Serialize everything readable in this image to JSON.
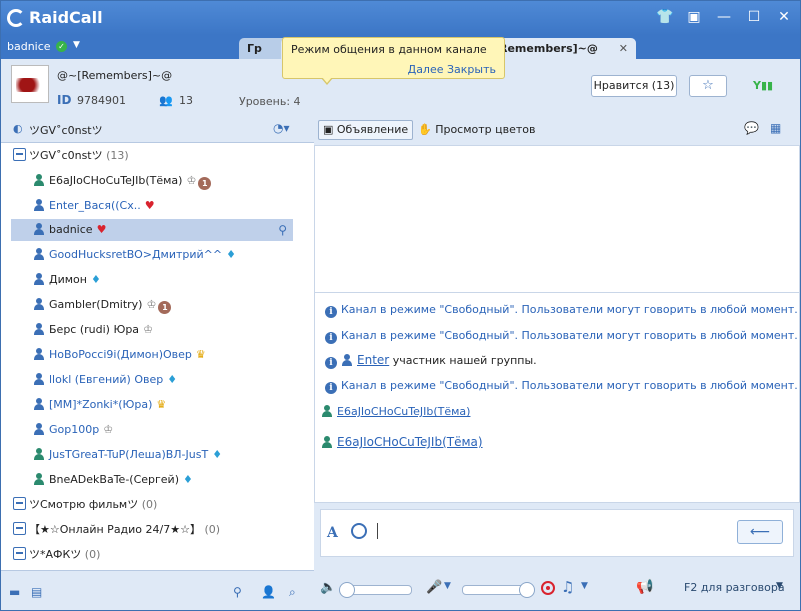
{
  "app": {
    "logo": "RaidCall"
  },
  "titlebar_icons": [
    "shirt-icon",
    "wardrobe-icon",
    "minimize-icon",
    "maximize-icon",
    "close-icon"
  ],
  "titlebar_glyphs": [
    "👕",
    "▣",
    "—",
    "☐",
    "✕"
  ],
  "user": {
    "name": "badnice"
  },
  "tabs": {
    "tab1": "Гр",
    "tab2": "Remembers]~@",
    "close": "✕"
  },
  "tooltip": {
    "text": "Режим общения в данном канале",
    "link": "Далее Закрыть"
  },
  "channel": {
    "name": "@~[Remembers]~@",
    "id_label": "ID",
    "id_value": "9784901",
    "members": "13",
    "level": "Уровень: 4",
    "like": "Нравится (13)",
    "star": "☆"
  },
  "left": {
    "header": "ツGV˚c0nstツ",
    "tree": [
      {
        "kind": "group",
        "label": "ツGV˚c0nstツ",
        "count": "(13)"
      },
      {
        "kind": "user",
        "label": "E6aJIoCHoCuTeJIb(Тёма)",
        "color": "#2b8a6e",
        "badges": [
          {
            "t": "♔",
            "c": "b-crown"
          },
          {
            "t": "1",
            "c": "b-num"
          }
        ]
      },
      {
        "kind": "user",
        "label": "Enter_Вася((Сх..",
        "color": "#3b6fb6",
        "badges": [
          {
            "t": "♥",
            "c": "b-heart"
          }
        ],
        "blue": true
      },
      {
        "kind": "user",
        "label": "badnice",
        "color": "#3b6fb6",
        "badges": [
          {
            "t": "♥",
            "c": "b-heart"
          }
        ],
        "selected": true
      },
      {
        "kind": "user",
        "label": "GoodHucksretBO>Дмитрий^^",
        "color": "#3b6fb6",
        "badges": [
          {
            "t": "♦",
            "c": "b-diam"
          }
        ],
        "blue": true
      },
      {
        "kind": "user",
        "label": "Димон",
        "color": "#3b6fb6",
        "badges": [
          {
            "t": "♦",
            "c": "b-diam"
          }
        ]
      },
      {
        "kind": "user",
        "label": "Gambler(Dmitry)",
        "color": "#3b6fb6",
        "badges": [
          {
            "t": "♔",
            "c": "b-crown"
          },
          {
            "t": "1",
            "c": "b-num"
          }
        ]
      },
      {
        "kind": "user",
        "label": "Берс  (rudi)  Юра",
        "color": "#3b6fb6",
        "badges": [
          {
            "t": "♔",
            "c": "b-crown"
          }
        ]
      },
      {
        "kind": "user",
        "label": "HoBoPocci9i(Димон)Овер",
        "color": "#3b6fb6",
        "badges": [
          {
            "t": "♛",
            "c": "b-gold"
          }
        ],
        "blue": true
      },
      {
        "kind": "user",
        "label": "llokl (Евгений) Овер",
        "color": "#3b6fb6",
        "badges": [
          {
            "t": "♦",
            "c": "b-diam"
          }
        ],
        "blue": true
      },
      {
        "kind": "user",
        "label": "[MM]*Zonki*(Юра)",
        "color": "#3b6fb6",
        "badges": [
          {
            "t": "♛",
            "c": "b-gold"
          }
        ],
        "blue": true
      },
      {
        "kind": "user",
        "label": "Gop100p",
        "color": "#3b6fb6",
        "badges": [
          {
            "t": "♔",
            "c": "b-crown"
          }
        ],
        "blue": true
      },
      {
        "kind": "user",
        "label": "JusTGreaT-TuP(Леша)ВЛ-JusT",
        "color": "#2b8a6e",
        "badges": [
          {
            "t": "♦",
            "c": "b-diam"
          }
        ],
        "blue": true
      },
      {
        "kind": "user",
        "label": "BneADekBaTe-(Сергей)",
        "color": "#2b8a6e",
        "badges": [
          {
            "t": "♦",
            "c": "b-diam"
          }
        ]
      },
      {
        "kind": "group",
        "label": "ツСмотрю фильмツ",
        "count": "(0)"
      },
      {
        "kind": "group",
        "label": "【★☆Онлайн Радио 24/7★☆】",
        "count": "(0)"
      },
      {
        "kind": "group",
        "label": "ツ*АФКツ",
        "count": "(0)"
      }
    ]
  },
  "right": {
    "announce": "Объявление",
    "colors": "Просмотр цветов",
    "messages": [
      {
        "type": "info",
        "text": "Канал в режиме \"Свободный\". Пользователи могут говорить в любой момент."
      },
      {
        "type": "info",
        "text": "Канал в режиме \"Свободный\". Пользователи могут говорить в любой момент."
      },
      {
        "type": "join",
        "user": "Enter",
        "text": " участник нашей группы."
      },
      {
        "type": "info",
        "text": "Канал в режиме \"Свободный\". Пользователи могут говорить в любой момент."
      },
      {
        "type": "link",
        "text": "E6aJIoCHoCuTeJIb(Тёма)"
      },
      {
        "type": "link",
        "text": "E6aJIoCHoCuTeJIb(Тёма)",
        "big": true
      }
    ],
    "send": "⟵",
    "talk": "F2 для разговора"
  },
  "colors": {
    "accent": "#3b6fb6",
    "titlebar": "#3c76c6",
    "panel": "#dfe9f6",
    "green": "#37b34a",
    "heart": "#d9232e"
  }
}
